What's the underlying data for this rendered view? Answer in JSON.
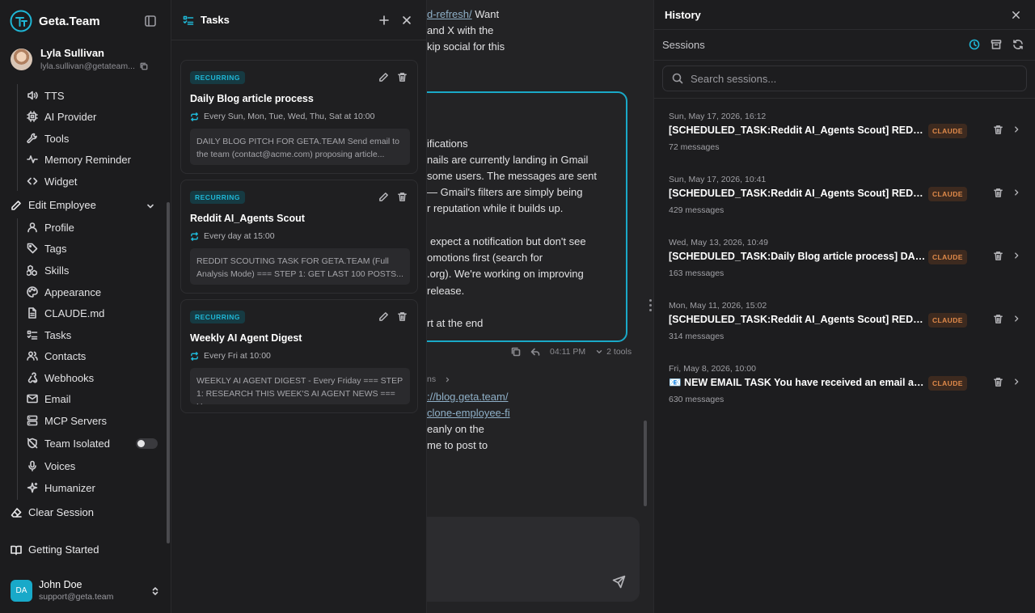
{
  "brand": {
    "name": "Geta.Team"
  },
  "user": {
    "name": "Lyla Sullivan",
    "email": "lyla.sullivan@getateam..."
  },
  "nav": {
    "top_items": [
      {
        "label": "TTS",
        "icon": "speaker-icon"
      },
      {
        "label": "AI Provider",
        "icon": "chip-icon"
      },
      {
        "label": "Tools",
        "icon": "wrench-icon"
      },
      {
        "label": "Memory Reminder",
        "icon": "pulse-icon"
      },
      {
        "label": "Widget",
        "icon": "code-icon"
      }
    ],
    "edit_employee": "Edit Employee",
    "sub_items": [
      {
        "label": "Profile",
        "icon": "user-icon"
      },
      {
        "label": "Tags",
        "icon": "tag-icon"
      },
      {
        "label": "Skills",
        "icon": "boxes-icon"
      },
      {
        "label": "Appearance",
        "icon": "palette-icon"
      },
      {
        "label": "CLAUDE.md",
        "icon": "file-icon"
      },
      {
        "label": "Tasks",
        "icon": "list-check-icon"
      },
      {
        "label": "Contacts",
        "icon": "users-icon"
      },
      {
        "label": "Webhooks",
        "icon": "webhook-icon"
      },
      {
        "label": "Email",
        "icon": "mail-icon"
      },
      {
        "label": "MCP Servers",
        "icon": "server-icon"
      },
      {
        "label": "Team Isolated",
        "icon": "shield-off-icon"
      },
      {
        "label": "Voices",
        "icon": "mic-icon"
      },
      {
        "label": "Humanizer",
        "icon": "sparkles-icon"
      }
    ],
    "clear_session": "Clear Session",
    "getting_started": "Getting Started"
  },
  "account": {
    "initials": "DA",
    "name": "John Doe",
    "email": "support@geta.team"
  },
  "tasks_panel": {
    "title": "Tasks",
    "tasks": [
      {
        "badge": "RECURRING",
        "title": "Daily Blog article process",
        "schedule": "Every Sun, Mon, Tue, Wed, Thu, Sat at 10:00",
        "body": "DAILY BLOG PITCH FOR GETA.TEAM Send email to the team (contact@acme.com) proposing article..."
      },
      {
        "badge": "RECURRING",
        "title": "Reddit AI_Agents Scout",
        "schedule": "Every day at 15:00",
        "body": "REDDIT SCOUTING TASK FOR GETA.TEAM (Full Analysis Mode) === STEP 1: GET LAST 100 POSTS..."
      },
      {
        "badge": "RECURRING",
        "title": "Weekly AI Agent Digest",
        "schedule": "Every Fri at 10:00",
        "body": "WEEKLY AI AGENT DIGEST - Every Friday === STEP 1: RESEARCH THIS WEEK'S AI AGENT NEWS === U..."
      }
    ]
  },
  "chat": {
    "lines_top": [
      {
        "text": "d-refresh/",
        "link": true,
        "suffix": " Want"
      },
      {
        "text": "and X with the",
        "link": false,
        "suffix": ""
      },
      {
        "text": "kip social for this",
        "link": false,
        "suffix": ""
      }
    ],
    "bubble_lines": [
      "ifications",
      "nails are currently landing in Gmail",
      "some users. The messages are sent",
      "— Gmail's filters are simply being",
      "r reputation while it builds up.",
      "",
      "expect a notification but don't see",
      "omotions first (search for",
      ".org). We're working on improving",
      "release.",
      "",
      "rt at the end"
    ],
    "time": "04:11 PM",
    "tools": "2 tools",
    "crumb": "ns",
    "lines_bottom": [
      {
        "text": "://blog.geta.team/",
        "link": true
      },
      {
        "text": "clone-employee-fi",
        "link": true
      },
      {
        "text": "eanly on the",
        "link": false
      },
      {
        "text": "me to post to",
        "link": false
      }
    ]
  },
  "history": {
    "title": "History",
    "sessions_label": "Sessions",
    "search_placeholder": "Search sessions...",
    "sessions": [
      {
        "date": "Sun, May 17, 2026, 16:12",
        "title": "[SCHEDULED_TASK:Reddit AI_Agents Scout] REDDIT S...",
        "badge": "CLAUDE",
        "count": "72 messages"
      },
      {
        "date": "Sun, May 17, 2026, 10:41",
        "title": "[SCHEDULED_TASK:Reddit AI_Agents Scout] REDDIT S...",
        "badge": "CLAUDE",
        "count": "429 messages"
      },
      {
        "date": "Wed, May 13, 2026, 10:49",
        "title": "[SCHEDULED_TASK:Daily Blog article process] DAILY B...",
        "badge": "CLAUDE",
        "count": "163 messages"
      },
      {
        "date": "Mon, May 11, 2026, 15:02",
        "title": "[SCHEDULED_TASK:Reddit AI_Agents Scout] REDDIT S...",
        "badge": "CLAUDE",
        "count": "314 messages"
      },
      {
        "date": "Fri, May 8, 2026, 10:00",
        "title": "📧 NEW EMAIL TASK You have received an email at: /o...",
        "badge": "CLAUDE",
        "count": "630 messages"
      }
    ]
  },
  "colors": {
    "accent": "#1fb7d6",
    "claude_badge": "#e08a4a",
    "background": "#1b1b1d"
  }
}
